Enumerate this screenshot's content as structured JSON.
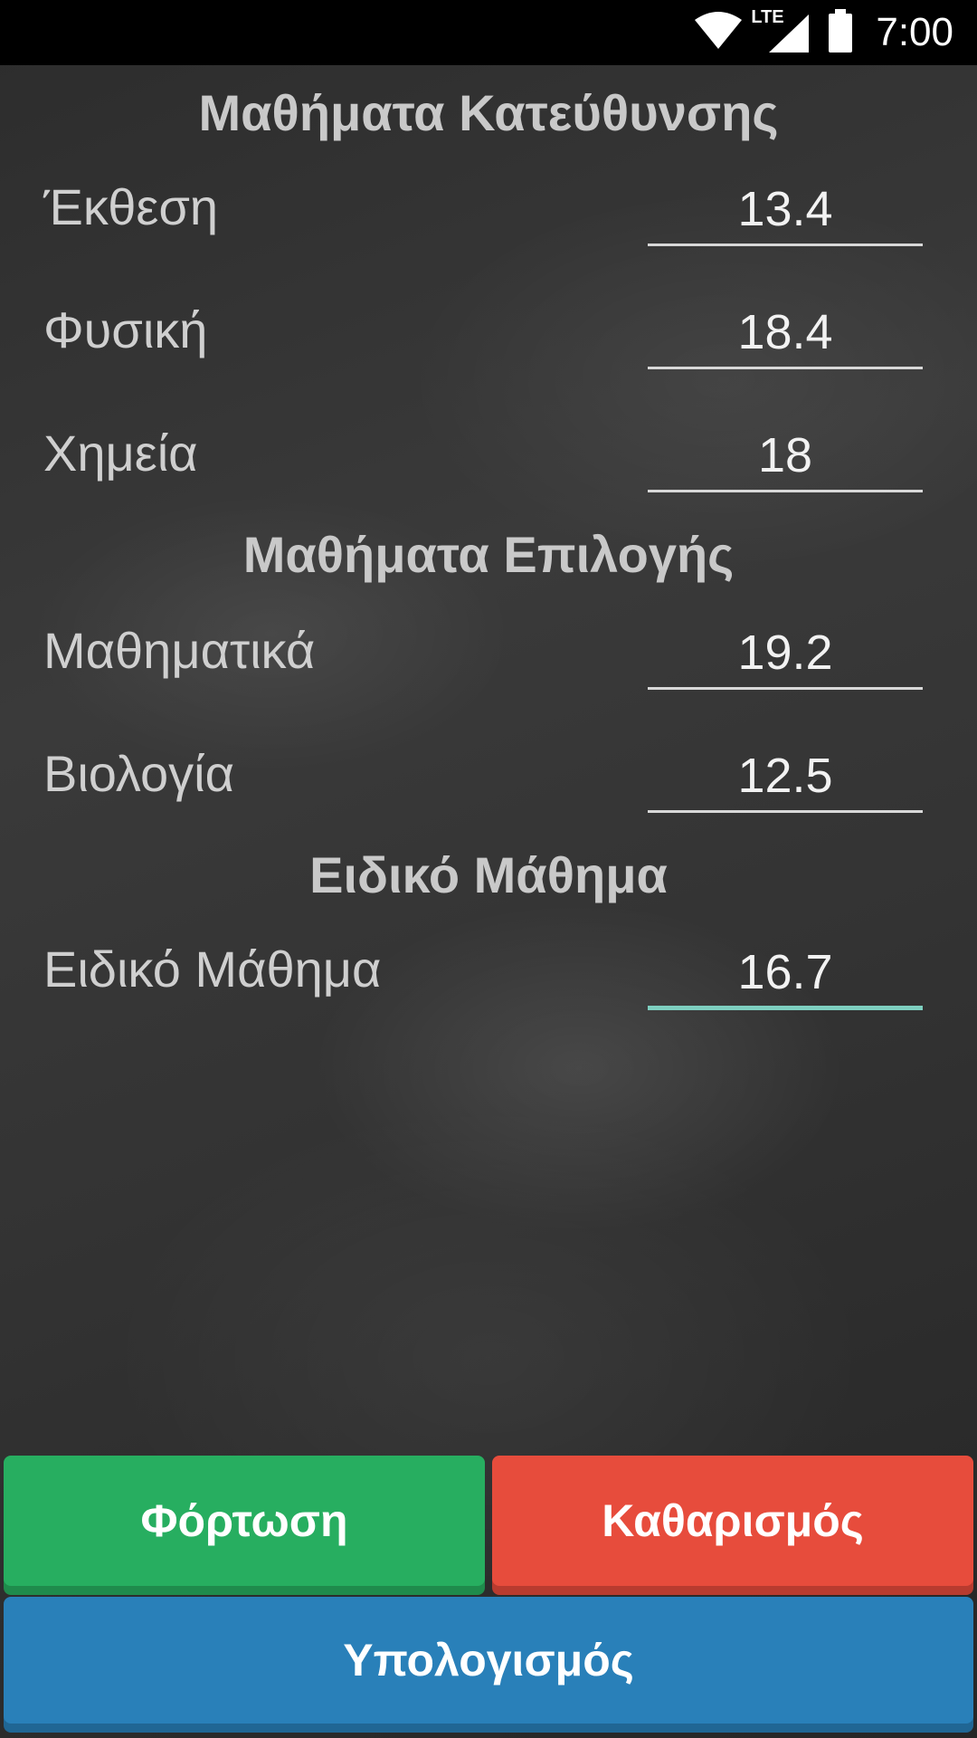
{
  "status_bar": {
    "time": "7:00",
    "network_label": "LTE",
    "icons": [
      "wifi-icon",
      "lte-signal-icon",
      "battery-icon"
    ]
  },
  "sections": {
    "direction": {
      "title": "Μαθήματα Κατεύθυνσης"
    },
    "elective": {
      "title": "Μαθήματα Επιλογής"
    },
    "special": {
      "title": "Ειδικό Μάθημα"
    }
  },
  "subjects": {
    "essay": {
      "label": "Έκθεση",
      "value": "13.4"
    },
    "physics": {
      "label": "Φυσική",
      "value": "18.4"
    },
    "chemistry": {
      "label": "Χημεία",
      "value": "18"
    },
    "math": {
      "label": "Μαθηματικά",
      "value": "19.2"
    },
    "biology": {
      "label": "Βιολογία",
      "value": "12.5"
    },
    "special": {
      "label": "Ειδικό Μάθημα",
      "value": "16.7"
    }
  },
  "buttons": {
    "load": "Φόρτωση",
    "clear": "Καθαρισμός",
    "calculate": "Υπολογισμός"
  },
  "colors": {
    "load": "#27ae60",
    "clear": "#e74c3c",
    "calculate": "#2980b9",
    "active_underline": "#7ecfc0"
  }
}
